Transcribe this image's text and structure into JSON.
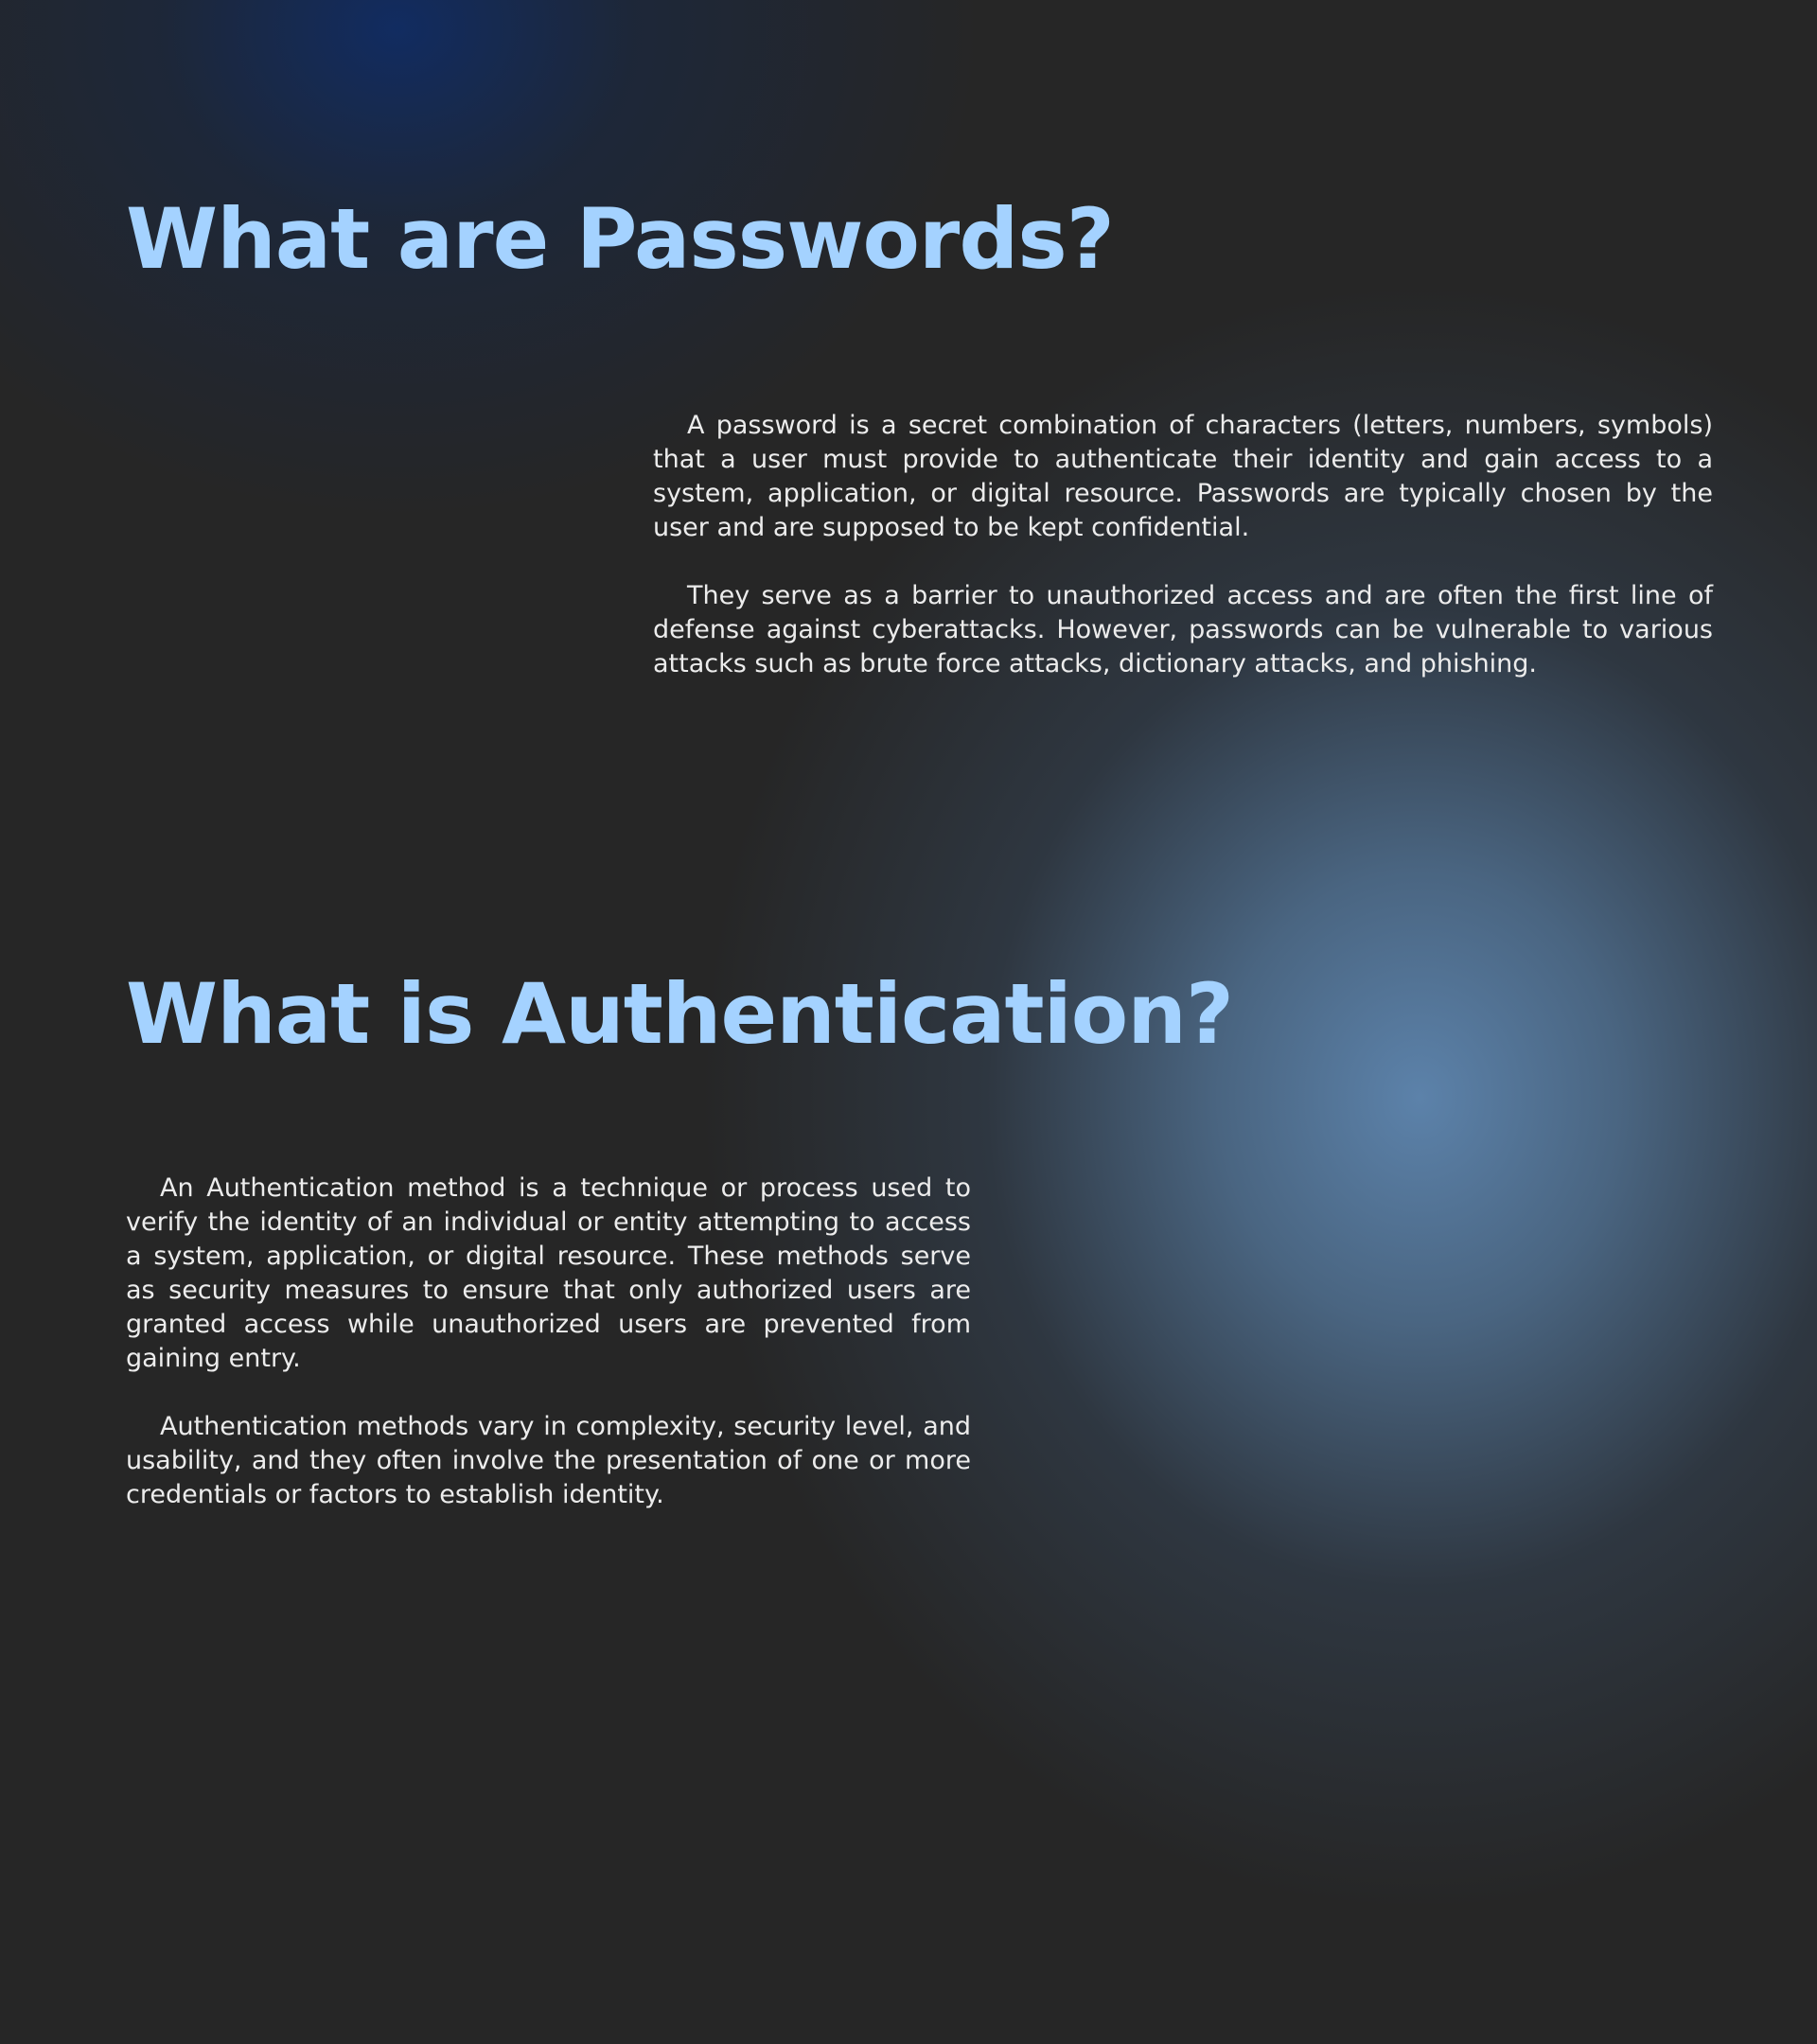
{
  "passwords_section": {
    "heading": "What are Passwords?",
    "paragraphs": [
      "A password is a secret combination of characters (letters, numbers, symbols) that a user must provide to authenticate their identity and gain access to a system, application, or digital resource. Passwords are typically chosen by the user and are supposed to be kept confidential.",
      "They serve as a barrier to unauthorized access and are often the first line of defense against cyberattacks. However, passwords can be vulnerable to various attacks such as brute force attacks, dictionary attacks, and phishing."
    ]
  },
  "authentication_section": {
    "heading": "What is Authentication?",
    "paragraphs": [
      "An Authentication method is a technique or process used to verify the identity of an individual or entity attempting to access a system, application, or digital resource. These methods serve as security measures to ensure that only authorized users are granted access while unauthorized users are prevented from gaining entry.",
      "Authentication methods vary in complexity, security level, and usability, and they often involve the presentation of one or more credentials or factors to establish identity."
    ]
  },
  "colors": {
    "background": "#262626",
    "heading": "#a4d2ff",
    "body_text": "#ececec",
    "glow_top": "#102c64",
    "glow_right": "#5c82aa"
  }
}
